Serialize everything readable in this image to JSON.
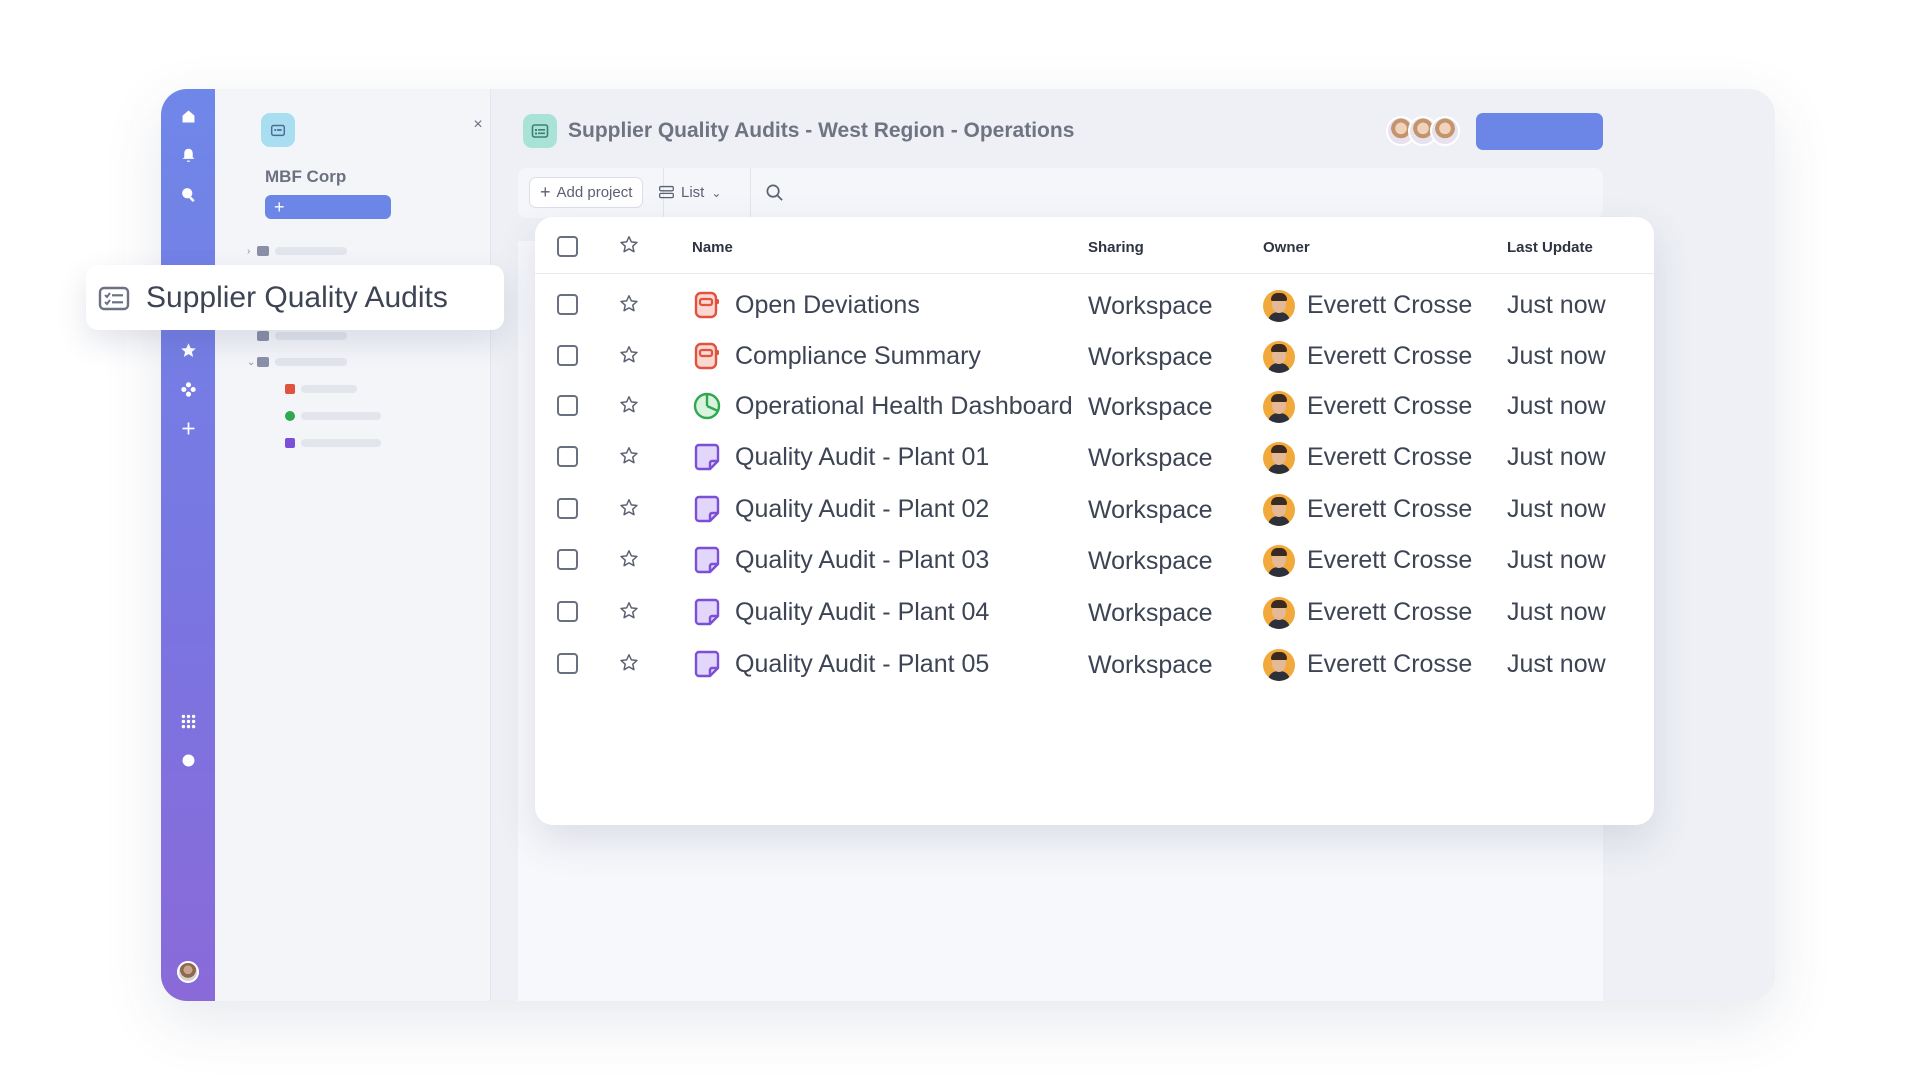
{
  "workspace": {
    "name": "MBF Corp",
    "add_label": "+"
  },
  "page": {
    "title": "Supplier Quality Audits - West Region - Operations"
  },
  "toolbar": {
    "add_project": "Add project",
    "view_label": "List"
  },
  "floating_chip": {
    "label": "Supplier Quality Audits"
  },
  "table": {
    "headers": {
      "name": "Name",
      "sharing": "Sharing",
      "owner": "Owner",
      "last_update": "Last Update"
    },
    "rows": [
      {
        "icon": "report-icon",
        "name": "Open Deviations",
        "sharing": "Workspace",
        "owner": "Everett Crosse",
        "updated": "Just now"
      },
      {
        "icon": "report-icon",
        "name": "Compliance Summary",
        "sharing": "Workspace",
        "owner": "Everett Crosse",
        "updated": "Just now"
      },
      {
        "icon": "pie-chart-icon",
        "name": "Operational Health Dashboard",
        "sharing": "Workspace",
        "owner": "Everett Crosse",
        "updated": "Just now"
      },
      {
        "icon": "document-icon",
        "name": "Quality Audit - Plant 01",
        "sharing": "Workspace",
        "owner": "Everett Crosse",
        "updated": "Just now"
      },
      {
        "icon": "document-icon",
        "name": "Quality Audit - Plant 02",
        "sharing": "Workspace",
        "owner": "Everett Crosse",
        "updated": "Just now"
      },
      {
        "icon": "document-icon",
        "name": "Quality Audit - Plant 03",
        "sharing": "Workspace",
        "owner": "Everett Crosse",
        "updated": "Just now"
      },
      {
        "icon": "document-icon",
        "name": "Quality Audit - Plant 04",
        "sharing": "Workspace",
        "owner": "Everett Crosse",
        "updated": "Just now"
      },
      {
        "icon": "document-icon",
        "name": "Quality Audit - Plant 05",
        "sharing": "Workspace",
        "owner": "Everett Crosse",
        "updated": "Just now"
      }
    ]
  },
  "rail_icons": [
    "home-icon",
    "bell-icon",
    "search-icon",
    "users-icon",
    "star-icon",
    "integrations-icon",
    "plus-icon",
    "apps-grid-icon",
    "help-icon"
  ],
  "colors": {
    "accent": "#6b86e6",
    "report": "#e0533f",
    "dashboard": "#2fa84f",
    "document": "#7b4fd6"
  }
}
